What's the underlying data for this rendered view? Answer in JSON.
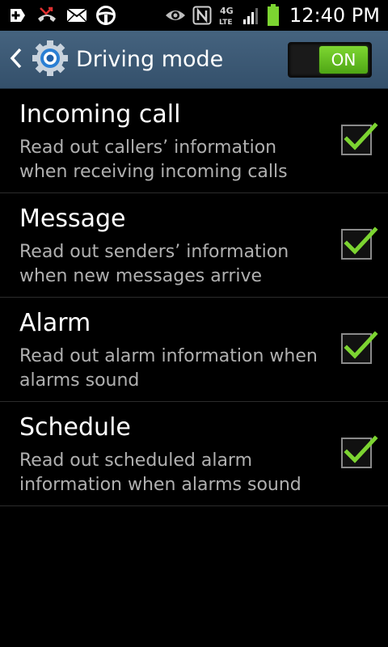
{
  "status_bar": {
    "time": "12:40 PM",
    "network": "4G LTE",
    "icons": [
      "add-notification-icon",
      "missed-call-icon",
      "email-icon",
      "steering-wheel-icon",
      "eye-icon",
      "nfc-icon",
      "network-4g-lte-icon",
      "signal-icon",
      "battery-icon"
    ]
  },
  "action_bar": {
    "title": "Driving mode",
    "toggle_label": "ON"
  },
  "colors": {
    "action_bar": "#3d5a76",
    "toggle_on": "#6ccb26",
    "check": "#7cd431",
    "subtitle": "#b0b0b0"
  },
  "settings": [
    {
      "title": "Incoming call",
      "description": "Read out callers’ information when receiving incoming calls",
      "checked": true
    },
    {
      "title": "Message",
      "description": "Read out senders’ information when new messages arrive",
      "checked": true
    },
    {
      "title": "Alarm",
      "description": "Read out alarm information when alarms sound",
      "checked": true
    },
    {
      "title": "Schedule",
      "description": "Read out scheduled alarm information when alarms sound",
      "checked": true
    }
  ]
}
